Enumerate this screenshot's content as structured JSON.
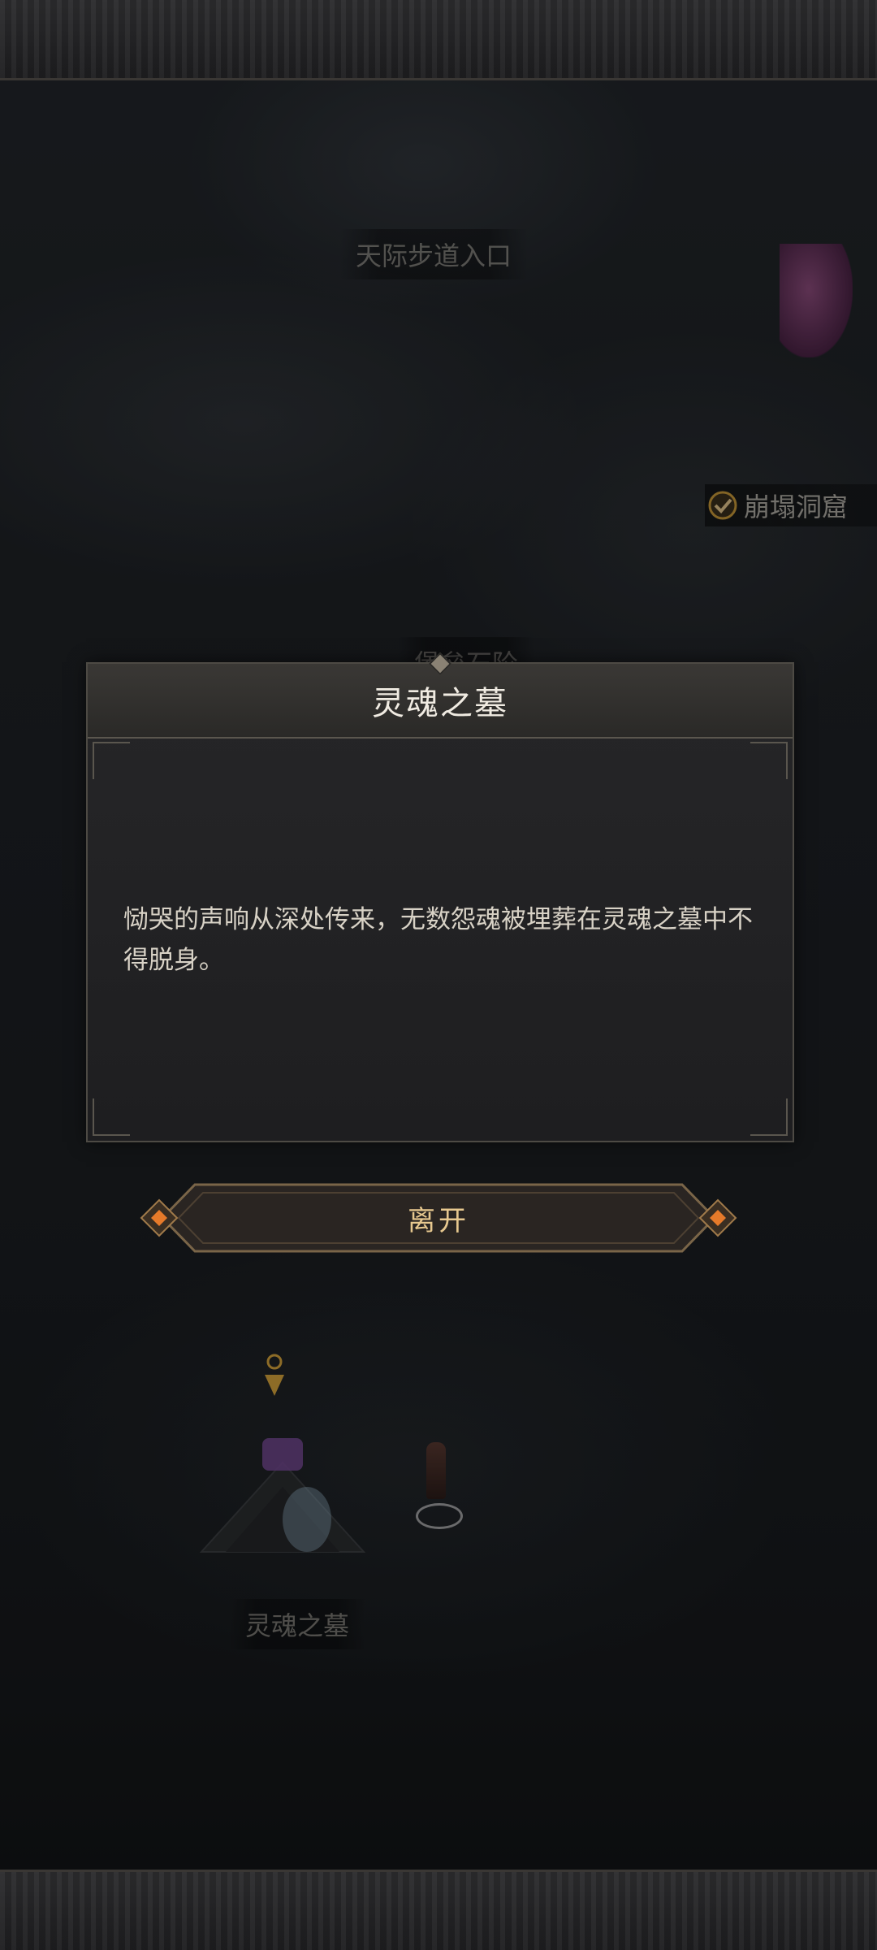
{
  "map": {
    "labels": {
      "sky_path_entrance": "天际步道入口",
      "collapsed_cave": "崩塌洞窟",
      "stone_steps": "堡垒石阶",
      "soul_tomb": "灵魂之墓"
    }
  },
  "dialog": {
    "title": "灵魂之墓",
    "body": "恸哭的声响从深处传来，无数怨魂被埋葬在灵魂之墓中不得脱身。",
    "leave_button": "离开"
  },
  "colors": {
    "accent": "#e7c88f",
    "cave_check": "#c99a3a"
  }
}
